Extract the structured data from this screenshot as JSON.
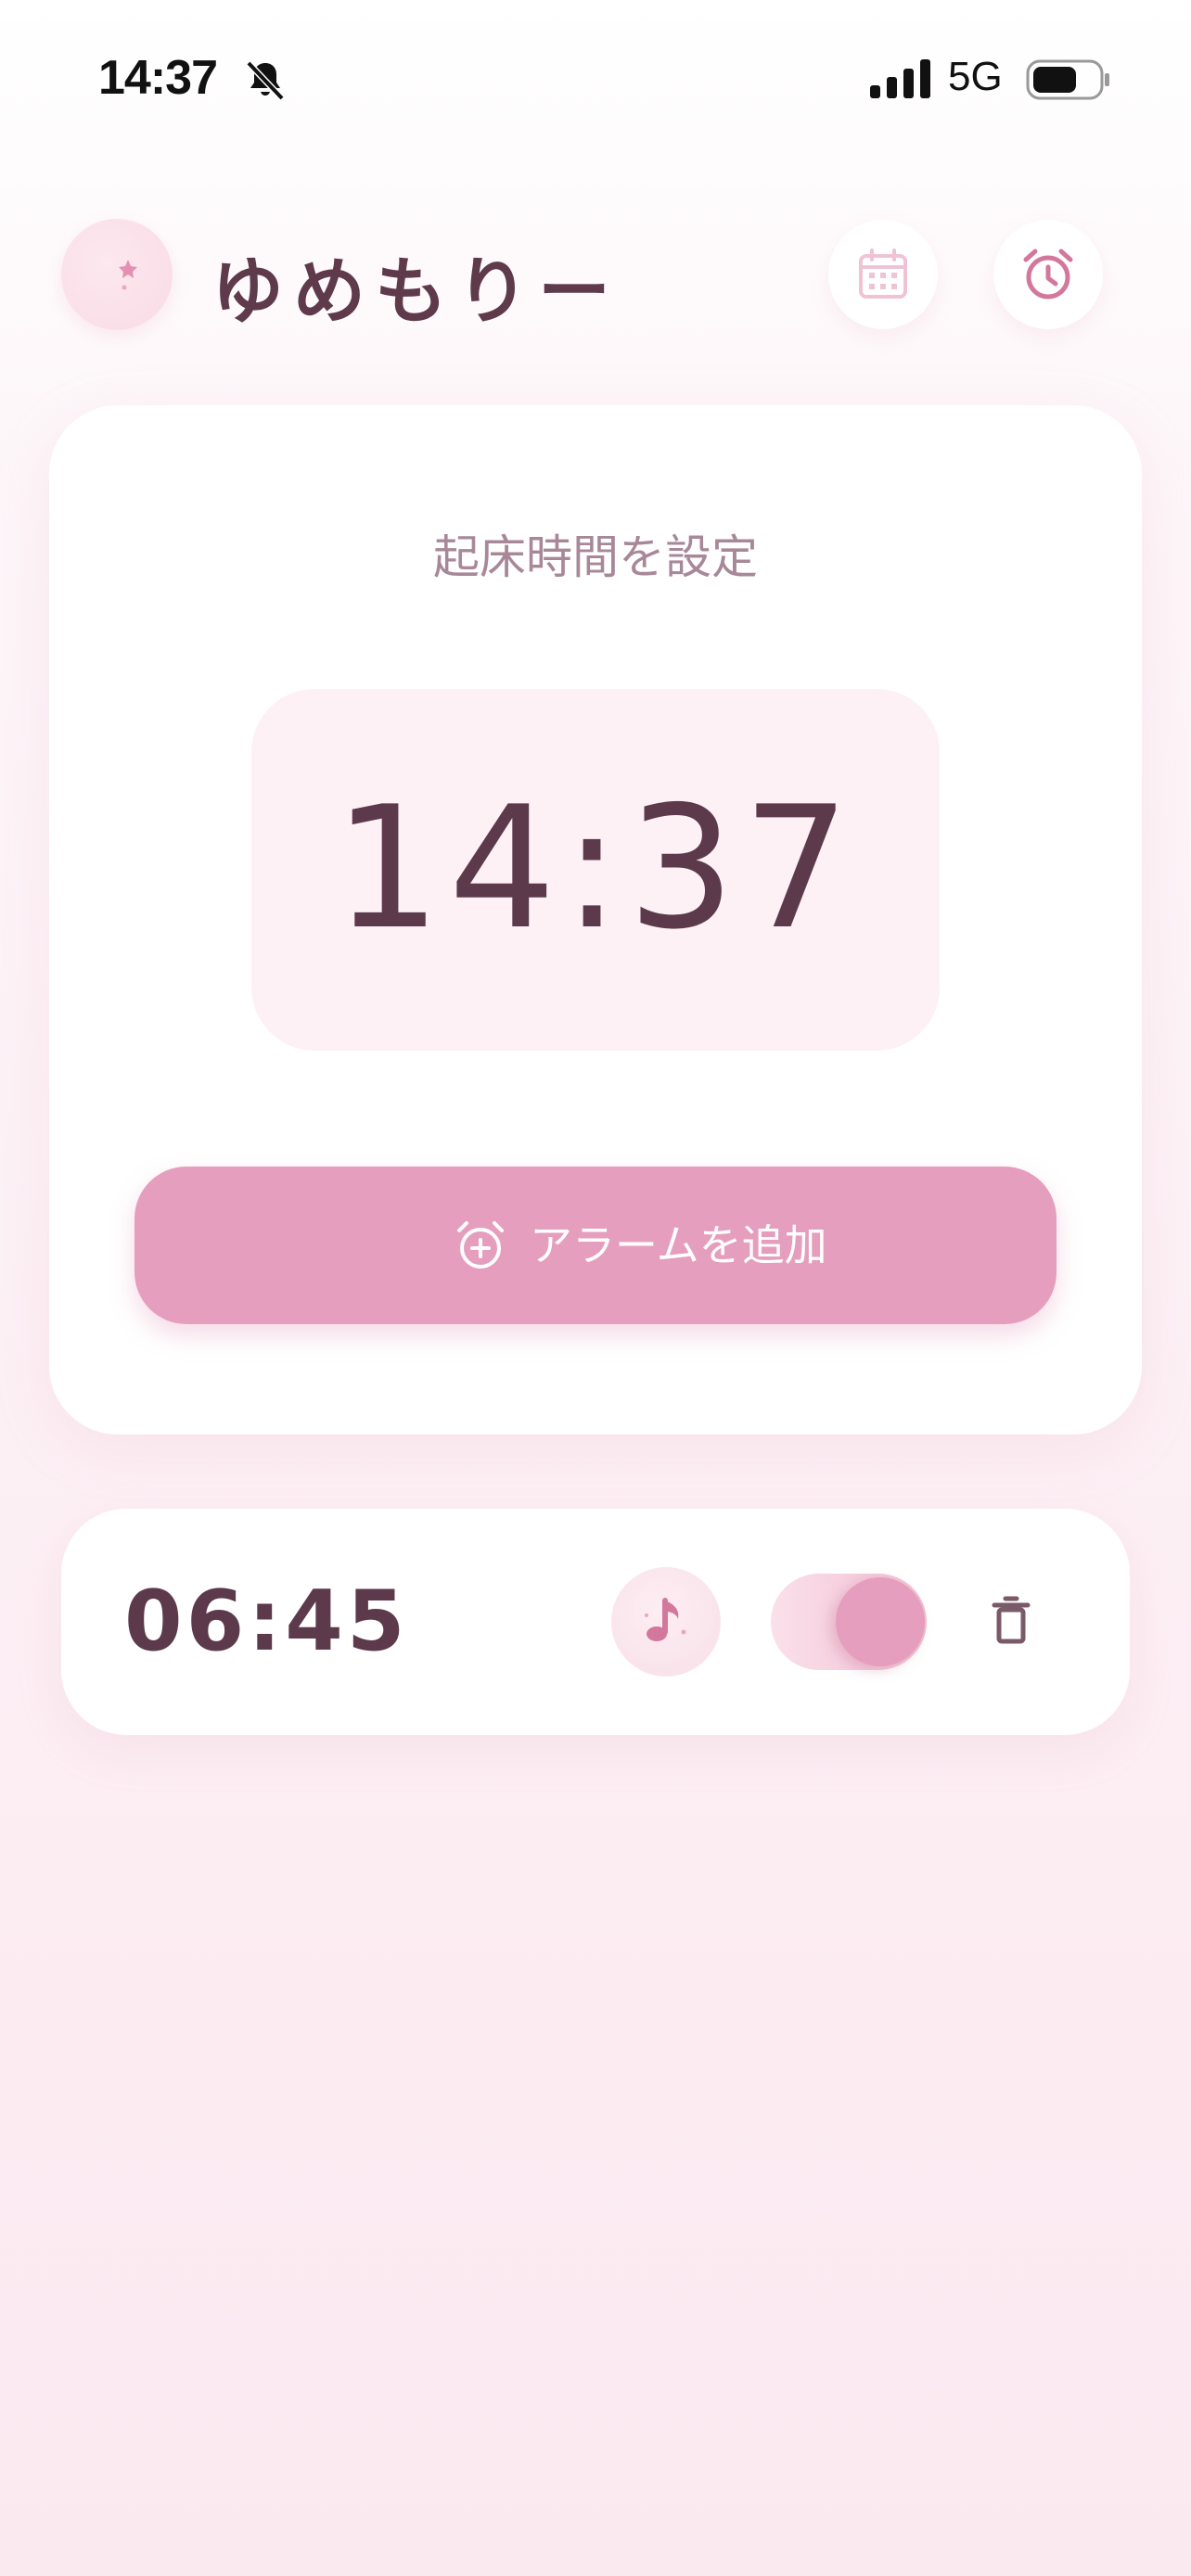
{
  "status_bar": {
    "time": "14:37",
    "network": "5G"
  },
  "header": {
    "app_title": "ゆめもりー"
  },
  "wake_card": {
    "title": "起床時間を設定",
    "time_value": "14:37",
    "add_button_label": "アラームを追加"
  },
  "alarms": [
    {
      "time": "06:45",
      "enabled": true
    }
  ],
  "colors": {
    "accent": "#e59ebd",
    "text_dark": "#5c3a4c",
    "text_muted": "#a88898",
    "background": "#fceff4"
  }
}
